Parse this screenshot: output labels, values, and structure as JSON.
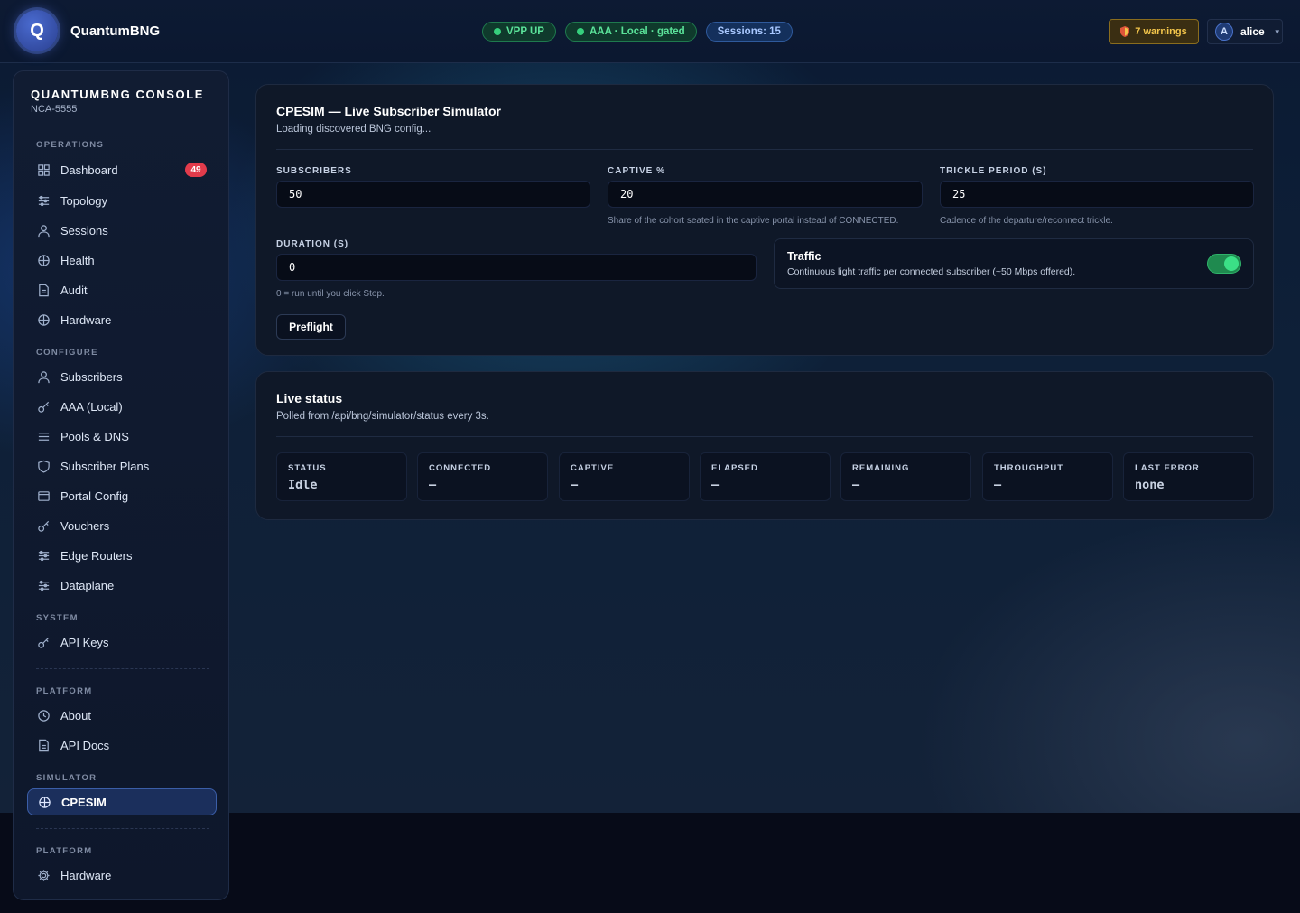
{
  "app": {
    "name": "QuantumBNG",
    "logo_letter": "Q"
  },
  "header": {
    "pills": [
      {
        "label": "VPP UP",
        "status": "green"
      },
      {
        "label": "AAA · Local · gated",
        "status": "green"
      },
      {
        "label": "Sessions: 15",
        "status": "blue"
      }
    ],
    "warnings_label": "7 warnings",
    "user": {
      "initial": "A",
      "name": "alice"
    }
  },
  "sidebar": {
    "title": "QUANTUMBNG CONSOLE",
    "subtitle": "NCA-5555",
    "sections": {
      "operations": "OPERATIONS",
      "configure": "CONFIGURE",
      "system": "SYSTEM",
      "platform": "PLATFORM",
      "simulator": "SIMULATOR",
      "platform2": "PLATFORM"
    },
    "items": {
      "dashboard": {
        "label": "Dashboard",
        "badge": "49"
      },
      "topology": "Topology",
      "sessions": "Sessions",
      "health": "Health",
      "audit": "Audit",
      "hardware": "Hardware",
      "subscribers": "Subscribers",
      "aaa": "AAA (Local)",
      "pools": "Pools & DNS",
      "plans": "Subscriber Plans",
      "portal": "Portal Config",
      "vouchers": "Vouchers",
      "edge": "Edge Routers",
      "dataplane": "Dataplane",
      "apikeys": "API Keys",
      "about": "About",
      "apidocs": "API Docs",
      "cpesim": "CPESIM",
      "hardware2": "Hardware"
    }
  },
  "simulator": {
    "title": "CPESIM — Live Subscriber Simulator",
    "subtitle": "Loading discovered BNG config...",
    "fields": {
      "subscribers": {
        "label": "SUBSCRIBERS",
        "value": "50"
      },
      "captive": {
        "label": "CAPTIVE %",
        "value": "20",
        "hint": "Share of the cohort seated in the captive portal instead of CONNECTED."
      },
      "trickle": {
        "label": "TRICKLE PERIOD (S)",
        "value": "25",
        "hint": "Cadence of the departure/reconnect trickle."
      },
      "duration": {
        "label": "DURATION (S)",
        "value": "0",
        "hint": "0 = run until you click Stop."
      }
    },
    "traffic": {
      "title": "Traffic",
      "description": "Continuous light traffic per connected subscriber (~50 Mbps offered).",
      "enabled": true
    },
    "preflight_label": "Preflight"
  },
  "live_status": {
    "title": "Live status",
    "subtitle": "Polled from /api/bng/simulator/status every 3s.",
    "stats": [
      {
        "label": "STATUS",
        "value": "Idle"
      },
      {
        "label": "CONNECTED",
        "value": "—"
      },
      {
        "label": "CAPTIVE",
        "value": "—"
      },
      {
        "label": "ELAPSED",
        "value": "—"
      },
      {
        "label": "REMAINING",
        "value": "—"
      },
      {
        "label": "THROUGHPUT",
        "value": "—"
      },
      {
        "label": "LAST ERROR",
        "value": "none"
      }
    ]
  },
  "colors": {
    "accent": "#3b5ea8",
    "success": "#36d07d",
    "warning": "#f4c64b",
    "danger": "#e23b4b"
  }
}
